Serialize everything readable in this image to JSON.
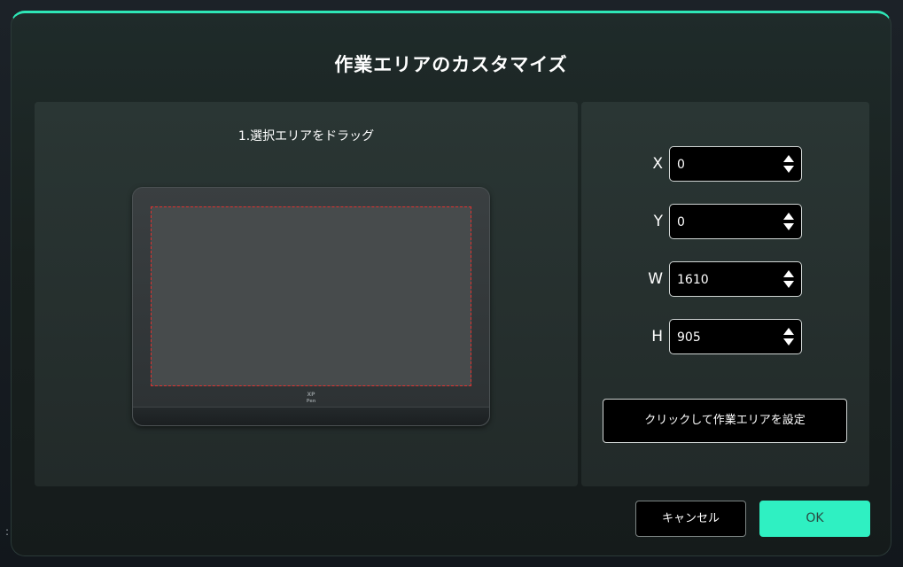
{
  "dialog": {
    "title": "作業エリアのカスタマイズ"
  },
  "preview": {
    "step_label": "1.選択エリアをドラッグ",
    "device_logo": "XP-Pen",
    "selection_color": "#e0312f"
  },
  "backdrop": {
    "edge_glyph": ":"
  },
  "fields": [
    {
      "label": "X",
      "value": "0"
    },
    {
      "label": "Y",
      "value": "0"
    },
    {
      "label": "W",
      "value": "1610"
    },
    {
      "label": "H",
      "value": "905"
    }
  ],
  "buttons": {
    "set_area": "クリックして作業エリアを設定",
    "cancel": "キャンセル",
    "ok": "OK"
  },
  "colors": {
    "accent": "#2ff0c2",
    "dialog_top_border": "#2ee6b6"
  },
  "icons": {
    "spin_arrows": "up-down-triangle-icon"
  }
}
